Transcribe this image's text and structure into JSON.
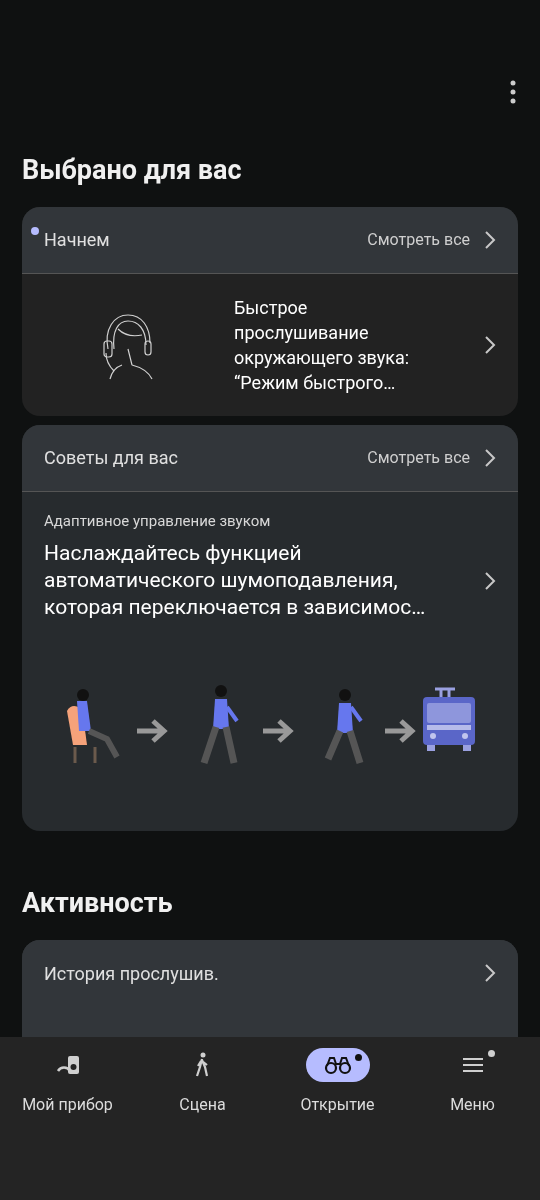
{
  "sections": [
    {
      "title": "Выбрано для вас",
      "cards": [
        {
          "kind": "intro",
          "header": "Начнем",
          "unread": true,
          "see_all": "Смотреть все",
          "text": "Быстрое прослушивание окружающего звука: “Режим быстрого…"
        },
        {
          "kind": "tip",
          "header": "Советы для вас",
          "unread": false,
          "see_all": "Смотреть все",
          "subtitle": "Адаптивное управление звуком",
          "text": "Наслаждайтесь функцией автоматического шумоподавления, которая переключается в зависимос…"
        }
      ]
    },
    {
      "title": "Активность",
      "cards": [
        {
          "kind": "row",
          "header": "История прослушив.",
          "unread": false
        }
      ]
    }
  ],
  "nav": [
    {
      "label": "Мой прибор",
      "selected": false,
      "badge": false
    },
    {
      "label": "Сцена",
      "selected": false,
      "badge": false
    },
    {
      "label": "Открытие",
      "selected": true,
      "badge": true
    },
    {
      "label": "Меню",
      "selected": false,
      "badge": true
    }
  ]
}
